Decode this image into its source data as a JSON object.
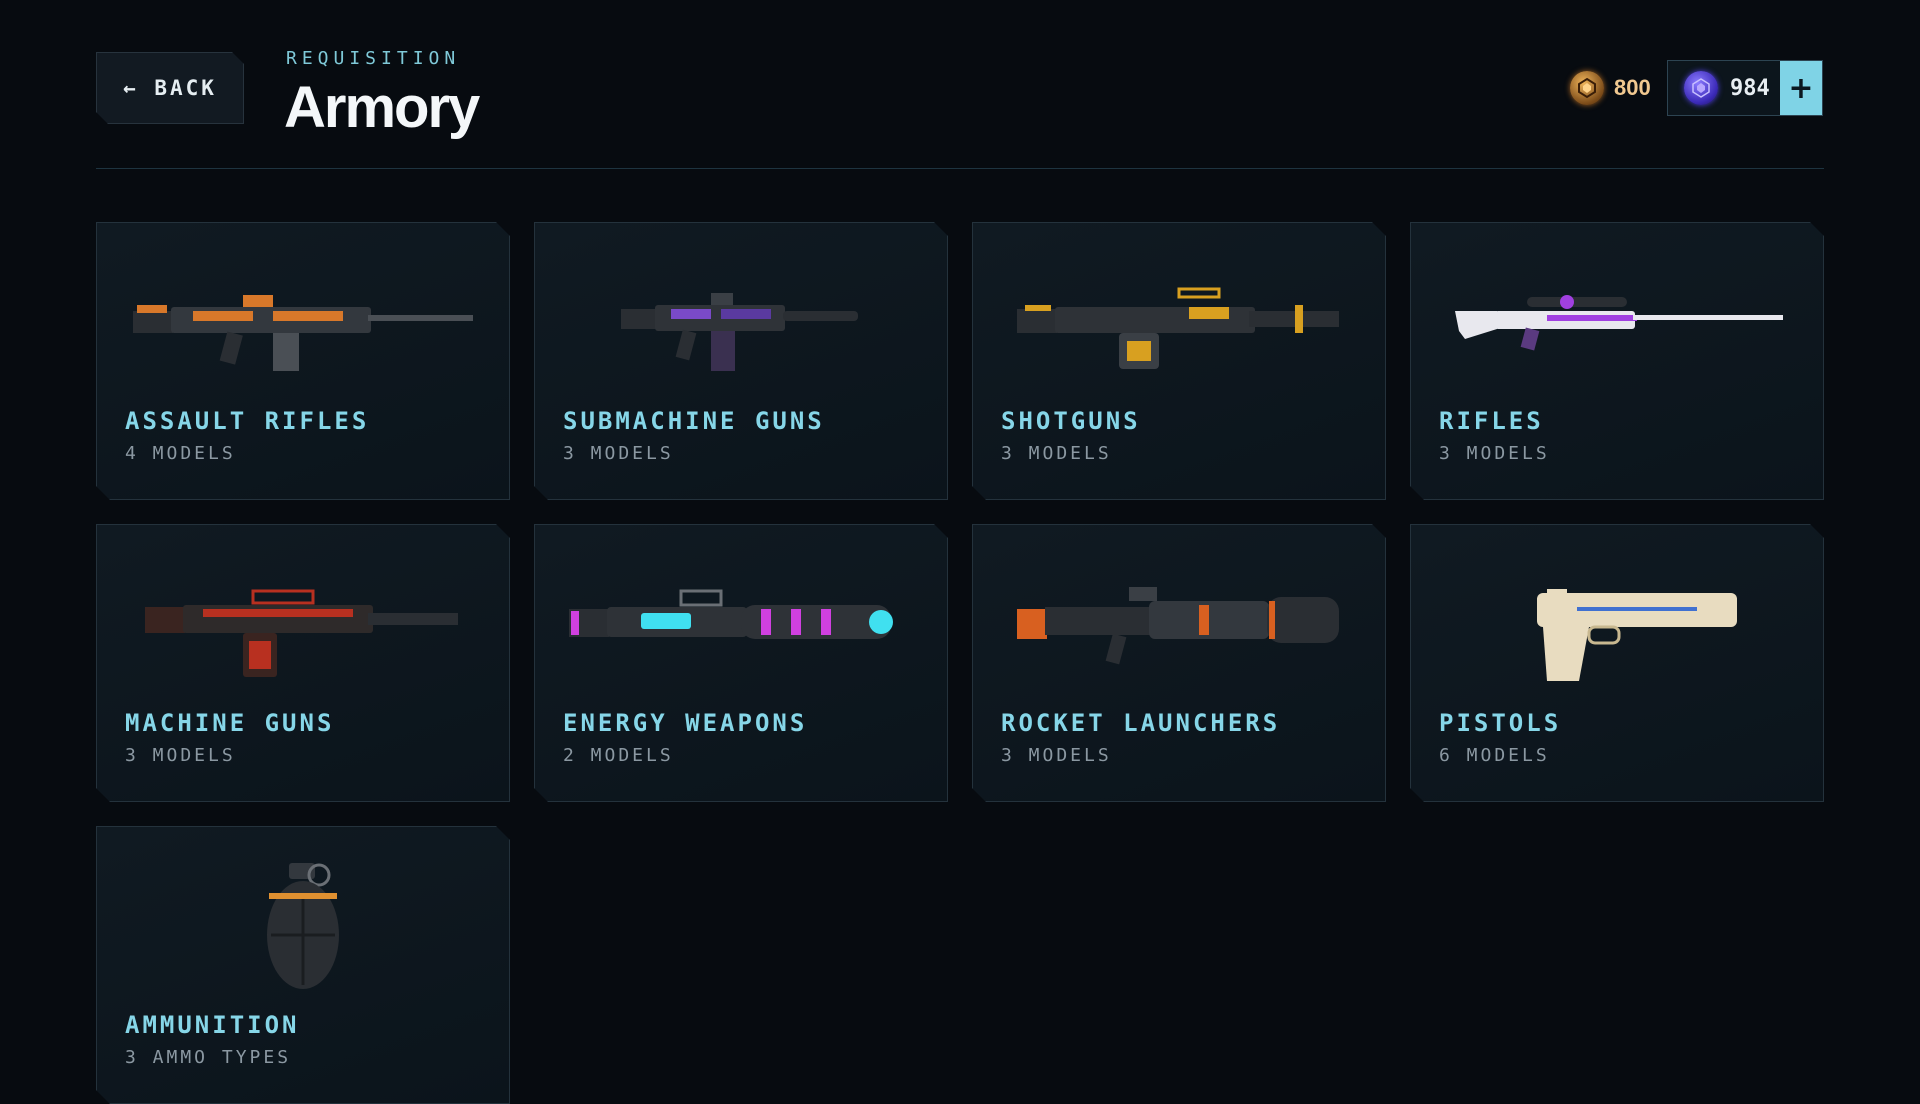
{
  "header": {
    "back_label": "← BACK",
    "subtitle": "REQUISITION",
    "title": "Armory"
  },
  "currency": {
    "gold": {
      "value": "800",
      "icon": "gold-coin-icon"
    },
    "premium": {
      "value": "984",
      "icon": "purple-gem-icon",
      "add_label": "+"
    }
  },
  "categories": [
    {
      "name": "ASSAULT RIFLES",
      "count": "4 MODELS",
      "icon": "assault-rifle-icon",
      "accent": "#d8782a"
    },
    {
      "name": "SUBMACHINE GUNS",
      "count": "3 MODELS",
      "icon": "submachine-gun-icon",
      "accent": "#7a4ac8"
    },
    {
      "name": "SHOTGUNS",
      "count": "3 MODELS",
      "icon": "shotgun-icon",
      "accent": "#d8a020"
    },
    {
      "name": "RIFLES",
      "count": "3 MODELS",
      "icon": "sniper-rifle-icon",
      "accent": "#a040e0"
    },
    {
      "name": "MACHINE GUNS",
      "count": "3 MODELS",
      "icon": "machine-gun-icon",
      "accent": "#b83020"
    },
    {
      "name": "ENERGY WEAPONS",
      "count": "2 MODELS",
      "icon": "energy-weapon-icon",
      "accent": "#d040e0"
    },
    {
      "name": "ROCKET LAUNCHERS",
      "count": "3 MODELS",
      "icon": "rocket-launcher-icon",
      "accent": "#d86020"
    },
    {
      "name": "PISTOLS",
      "count": "6 MODELS",
      "icon": "pistol-icon",
      "accent": "#e8dcc0"
    },
    {
      "name": "AMMUNITION",
      "count": "3 AMMO TYPES",
      "icon": "grenade-icon",
      "accent": "#e09030"
    }
  ]
}
